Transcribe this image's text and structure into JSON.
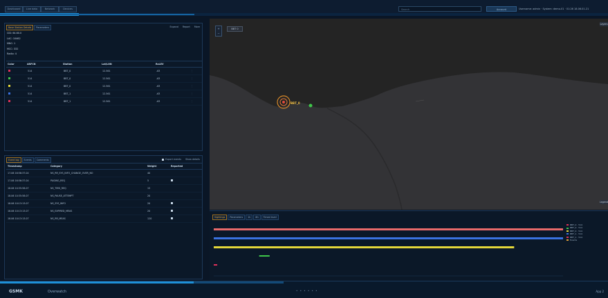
{
  "topbar": {
    "tabs": [
      "Dashboard",
      "Live data",
      "Network",
      "Devices"
    ],
    "search_placeholder": "Search",
    "account_button": "Account",
    "status_text": "Username: admin · System: demo-01 · 01:26 18.06.01.21"
  },
  "cells_panel": {
    "tabs": [
      "Base Station Details",
      "Parameters"
    ],
    "actions": [
      "Expand",
      "Report",
      "More"
    ],
    "info": [
      "CID: 64.60.0",
      "LAC: 10462",
      "MNC: 1",
      "MCC: 332",
      "Radio: 4"
    ],
    "columns": [
      "Color",
      "ARFCN",
      "Station",
      "Lat/LON",
      "RxLEV",
      ""
    ],
    "rows": [
      {
        "color": "#e0305a",
        "arfcn": "514",
        "station": "BBT_0",
        "latlon": "12.561",
        "rxlev": "-63"
      },
      {
        "color": "#3fc84a",
        "arfcn": "514",
        "station": "BBT_0",
        "latlon": "12.561",
        "rxlev": "-63"
      },
      {
        "color": "#e6d83a",
        "arfcn": "514",
        "station": "BBT_0",
        "latlon": "12.561",
        "rxlev": "-63"
      },
      {
        "color": "#3a72e0",
        "arfcn": "514",
        "station": "BBT_1",
        "latlon": "12.561",
        "rxlev": "-63"
      },
      {
        "color": "#e0305a",
        "arfcn": "514",
        "station": "BBT_1",
        "latlon": "12.561",
        "rxlev": "-63"
      }
    ]
  },
  "events_panel": {
    "tabs": [
      "Event log",
      "Events",
      "Comments"
    ],
    "export_label": "Export events",
    "show_label": "Show details",
    "columns": [
      "Timestamp",
      "Category",
      "Weight",
      "Reported"
    ],
    "rows": [
      {
        "ts": "17.06 16:56:37.04",
        "cat": "NS_RR_SYS_INFO_CHANGE_OVER_NO",
        "w": "40",
        "r": false
      },
      {
        "ts": "17.06 16:56:37.04",
        "cat": "PAGING_REQ",
        "w": "5",
        "r": true
      },
      {
        "ts": "18.06 10:35:58.07",
        "cat": "NS_TMSI_REQ",
        "w": "15",
        "r": false
      },
      {
        "ts": "18.06 10:35:58.07",
        "cat": "NS_PAUSE_ATTEMPT",
        "w": "20",
        "r": false
      },
      {
        "ts": "18.06 10:13:13.07",
        "cat": "NS_SYS_INFO",
        "w": "20",
        "r": true
      },
      {
        "ts": "18.06 10:13:13.07",
        "cat": "NS_EXPIRED_MEAS",
        "w": "20",
        "r": true
      },
      {
        "ts": "18.06 10:13:13.07",
        "cat": "NS_RR_MEAS",
        "w": "120",
        "r": true
      }
    ]
  },
  "map": {
    "chip_label": "BBT 0",
    "legend_label": "Layers",
    "legend_label_bottom": "Legend",
    "pin_label": "BBT_0",
    "control_plus": "+",
    "control_minus": "−"
  },
  "timeline": {
    "tabs": [
      "Sightings",
      "Parameters",
      "1h",
      "6h",
      "Timed level"
    ],
    "legend": [
      {
        "label": "BBT_0 · 514",
        "color": "#e0305a"
      },
      {
        "label": "BBT_0 · 514",
        "color": "#3fc84a"
      },
      {
        "label": "BBT_0 · 514",
        "color": "#e6d83a"
      },
      {
        "label": "BBT_1 · 514",
        "color": "#3a72e0"
      },
      {
        "label": "BBT_1 · 514",
        "color": "#e0305a"
      },
      {
        "label": "Events",
        "color": "#e6a43a"
      }
    ],
    "bars": [
      {
        "color": "#e86a6a",
        "start": 0.0,
        "end": 1.0
      },
      {
        "color": "#3a72e0",
        "start": 0.0,
        "end": 1.0
      },
      {
        "color": "#e6d83a",
        "start": 0.0,
        "end": 0.86
      },
      {
        "color": "#3fc84a",
        "start": 0.13,
        "end": 0.16
      },
      {
        "color": "#e0305a",
        "start": 0.0,
        "end": 0.01
      }
    ]
  },
  "statusbar": {
    "brand": "GSMK",
    "app": "Overwatch",
    "dots": "• • • • • •",
    "version": "App 2"
  }
}
